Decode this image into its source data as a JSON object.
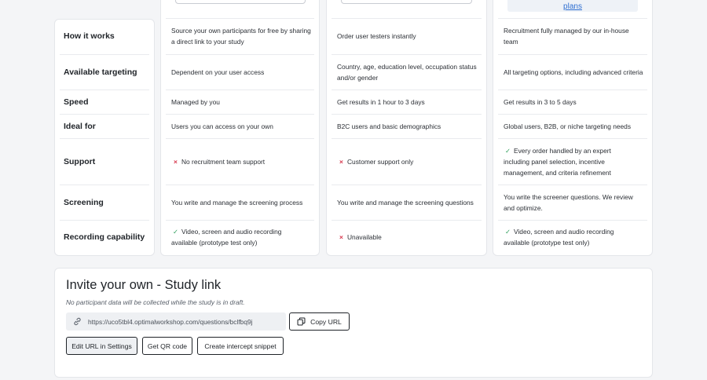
{
  "top": {
    "plans_link": "plans"
  },
  "rows": [
    {
      "label": "How it works",
      "col1": "Source your own participants for free by sharing a direct link to your study",
      "col2": "Order user testers instantly",
      "col3": "Recruitment fully managed by our in-house team"
    },
    {
      "label": "Available targeting",
      "col1": "Dependent on your user access",
      "col2": "Country, age, education level, occupation status and/or gender",
      "col3": "All targeting options, including advanced criteria"
    },
    {
      "label": "Speed",
      "col1": "Managed by you",
      "col2": "Get results in 1 hour to 3 days",
      "col3": "Get results in 3 to 5 days"
    },
    {
      "label": "Ideal for",
      "col1": "Users you can access on your own",
      "col2": "B2C users and basic demographics",
      "col3": "Global users, B2B, or niche targeting needs"
    },
    {
      "label": "Support",
      "col1": "No recruitment team support",
      "col2": "Customer support only",
      "col3": "Every order handled by an expert including panel selection, incentive management, and criteria refinement"
    },
    {
      "label": "Screening",
      "col1": "You write and manage the screening process",
      "col2": "You write and manage the screening questions",
      "col3": "You write the screener questions. We review and optimize."
    },
    {
      "label": "Recording capability",
      "col1": "Video, screen and audio recording available (prototype test only)",
      "col2": "Unavailable",
      "col3": "Video, screen and audio recording available (prototype test only)"
    }
  ],
  "invite": {
    "title": "Invite your own - Study link",
    "note": "No participant data will be collected while the study is in draft.",
    "url": "https://uco5tbl4.optimalworkshop.com/questions/bclfbq9j",
    "copy_label": "Copy URL",
    "edit_label": "Edit URL in Settings",
    "qr_label": "Get QR code",
    "intercept_label": "Create intercept snippet"
  },
  "colors": {
    "check": "#2e9e5b",
    "cross": "#d6344a",
    "link": "#2f6fd1"
  },
  "icons": {
    "check": "check-icon",
    "cross": "cross-icon",
    "link": "link-icon",
    "copy": "copy-icon"
  }
}
